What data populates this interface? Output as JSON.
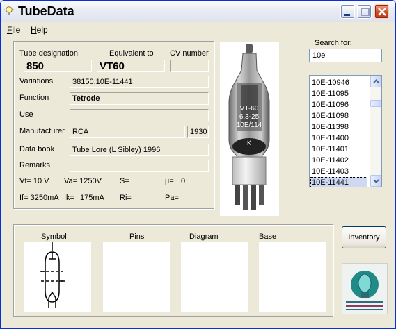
{
  "window": {
    "title": "TubeData"
  },
  "menu": {
    "file_underline": "F",
    "file_rest": "ile",
    "help_underline": "H",
    "help_rest": "elp"
  },
  "details": {
    "designation_label": "Tube designation",
    "designation": "850",
    "equivalent_label": "Equivalent to",
    "equivalent": "VT60",
    "cv_label": "CV number",
    "cv": "",
    "variations_label": "Variations",
    "variations": "38150,10E-11441",
    "function_label": "Function",
    "function": "Tetrode",
    "use_label": "Use",
    "use": "",
    "manufacturer_label": "Manufacturer",
    "manufacturer": "RCA",
    "year": "1930",
    "databook_label": "Data book",
    "databook": "Tube Lore (L Sibley) 1996",
    "remarks_label": "Remarks",
    "remarks": "",
    "vf": "Vf= 10 V",
    "va": "Va= 1250V",
    "s": "S=",
    "mu": "µ=",
    "mu_value": "0",
    "if": "If= 3250mA",
    "ik": "Ik=",
    "ik_value": "175mA",
    "ri": "Ri=",
    "pa": "Pa="
  },
  "photo": {
    "print_line1": "VT-60",
    "print_line2": "6.3-25",
    "print_line3": "10E/114",
    "print_line4": "K"
  },
  "search": {
    "label": "Search for:",
    "value": "10e"
  },
  "results": {
    "items": [
      "10E-10946",
      "10E-11095",
      "10E-11096",
      "10E-11098",
      "10E-11398",
      "10E-11400",
      "10E-11401",
      "10E-11402",
      "10E-11403",
      "10E-11441"
    ],
    "selected": "10E-11441"
  },
  "panels": {
    "symbol": "Symbol",
    "pins": "Pins",
    "diagram": "Diagram",
    "base": "Base"
  },
  "inventory_label": "Inventory",
  "colors": {
    "title_bar": "#e9ecf3",
    "close_button": "#d24b25",
    "selection": "#cfd8f2"
  }
}
